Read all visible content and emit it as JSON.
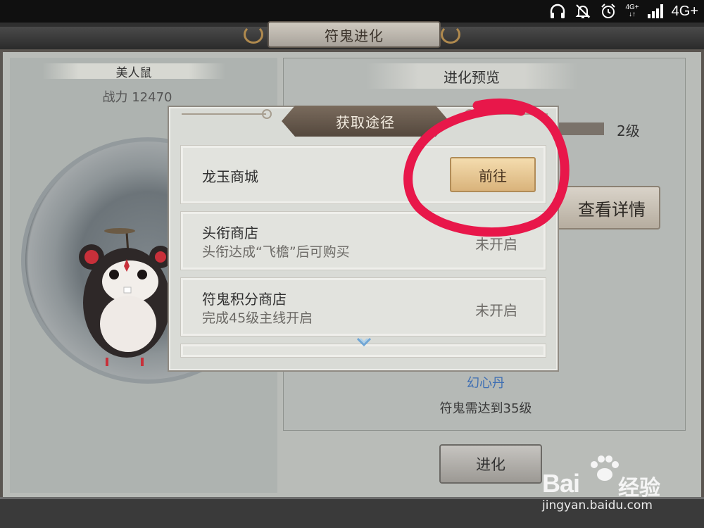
{
  "status_bar": {
    "network_small": "4G+",
    "network_small2": "↓↑",
    "network_label": "4G+",
    "icons": [
      "headphones-icon",
      "bell-muted-icon",
      "alarm-icon",
      "network-icon",
      "signal-icon"
    ]
  },
  "window": {
    "title": "符鬼进化"
  },
  "pet": {
    "name": "美人鼠",
    "power": "战力 12470"
  },
  "preview": {
    "title": "进化预览",
    "level_label": "2级",
    "detail_button": "查看详情",
    "material_name": "幻心丹",
    "requirement": "符鬼需达到35级",
    "evolve_button": "进化"
  },
  "popup": {
    "title": "获取途径",
    "sources": [
      {
        "name": "龙玉商城",
        "desc": "",
        "action": "前往",
        "status": ""
      },
      {
        "name": "头衔商店",
        "desc": "头衔达成“飞檐”后可购买",
        "action": "",
        "status": "未开启"
      },
      {
        "name": "符鬼积分商店",
        "desc": "完成45级主线开启",
        "action": "",
        "status": "未开启"
      }
    ]
  },
  "watermark": {
    "brand": "Bai",
    "brand_suffix": "经验",
    "url": "jingyan.baidu.com"
  },
  "colors": {
    "annotation_red": "#e8174a",
    "go_button": "#e9c690",
    "material_blue": "#3f6fb3"
  }
}
